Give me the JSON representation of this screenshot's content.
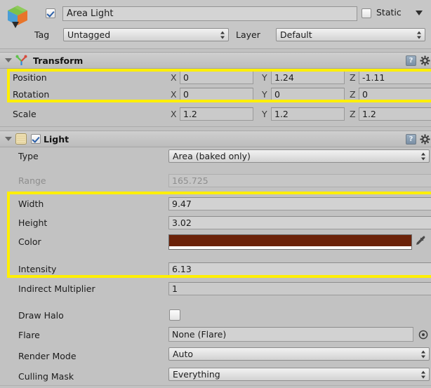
{
  "window": {
    "title": "Inspector"
  },
  "object_header": {
    "icon": "gameobject-cube-icon",
    "active_checkbox": true,
    "name": "Area Light",
    "static_label": "Static",
    "static_checked": false,
    "static_dropdown_icon": "chevron-down-icon",
    "tag_label": "Tag",
    "tag_value": "Untagged",
    "layer_label": "Layer",
    "layer_value": "Default"
  },
  "transform": {
    "title": "Transform",
    "icon": "transform-axis-icon",
    "expanded": true,
    "help_icon": "help-icon",
    "menu_icon": "gear-icon",
    "rows": [
      {
        "label": "Position",
        "x": "0",
        "y": "1.24",
        "z": "-1.11",
        "highlighted": true
      },
      {
        "label": "Rotation",
        "x": "0",
        "y": "0",
        "z": "0",
        "highlighted": true
      },
      {
        "label": "Scale",
        "x": "1.2",
        "y": "1.2",
        "z": "1.2",
        "highlighted": false
      }
    ],
    "axis_labels": {
      "x": "X",
      "y": "Y",
      "z": "Z"
    }
  },
  "light": {
    "title": "Light",
    "icon": "light-component-icon",
    "enabled_checkbox": true,
    "expanded": true,
    "help_icon": "help-icon",
    "menu_icon": "gear-icon",
    "type_label": "Type",
    "type_value": "Area (baked only)",
    "range_label": "Range",
    "range_value": "165.725",
    "range_disabled": true,
    "width_label": "Width",
    "width_value": "9.47",
    "height_label": "Height",
    "height_value": "3.02",
    "color_label": "Color",
    "color_value": "#6b2209",
    "color_alpha_bar": "#ffffff",
    "eyedropper_icon": "eyedropper-icon",
    "intensity_label": "Intensity",
    "intensity_value": "6.13",
    "indirect_label": "Indirect Multiplier",
    "indirect_value": "1",
    "draw_halo_label": "Draw Halo",
    "draw_halo_checked": false,
    "flare_label": "Flare",
    "flare_value": "None (Flare)",
    "flare_picker_icon": "object-picker-icon",
    "render_mode_label": "Render Mode",
    "render_mode_value": "Auto",
    "culling_mask_label": "Culling Mask",
    "culling_mask_value": "Everything"
  },
  "annotations": {
    "accent_color": "#ffef00",
    "boxes": [
      {
        "name": "transform-position-rotation-highlight"
      },
      {
        "name": "light-properties-highlight"
      }
    ]
  }
}
